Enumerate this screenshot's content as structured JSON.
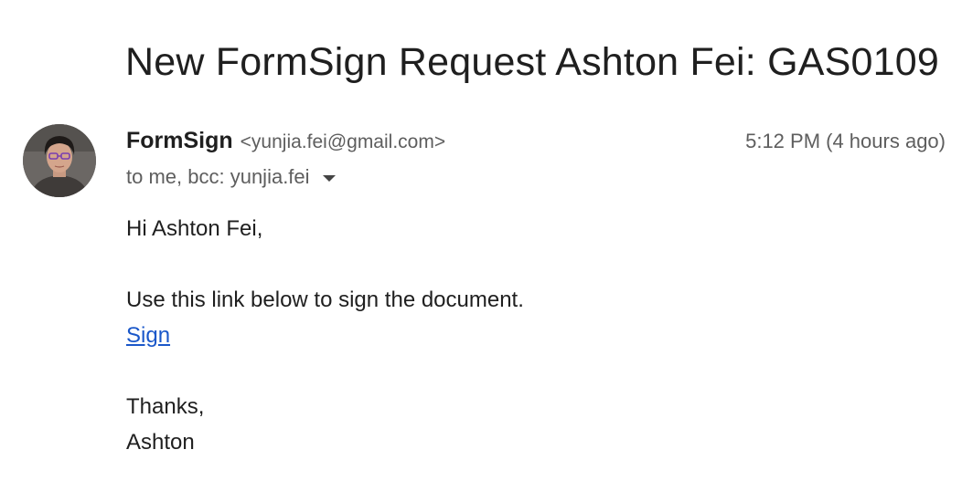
{
  "email": {
    "subject": "New FormSign Request Ashton Fei: GAS0109",
    "sender": {
      "name": "FormSign",
      "email": "<yunjia.fei@gmail.com>",
      "avatar": "user-avatar-photo"
    },
    "timestamp": "5:12 PM (4 hours ago)",
    "recipients": "to me, bcc: yunjia.fei",
    "recipients_icon": "chevron-down-icon",
    "body": {
      "greeting": "Hi Ashton Fei,",
      "instruction": "Use this link below to sign the document.",
      "link_label": "Sign",
      "closing": "Thanks,",
      "signature": "Ashton"
    }
  },
  "colors": {
    "link": "#1a57c9",
    "text": "#1f1f1f",
    "secondary_text": "#5e5e5e"
  }
}
